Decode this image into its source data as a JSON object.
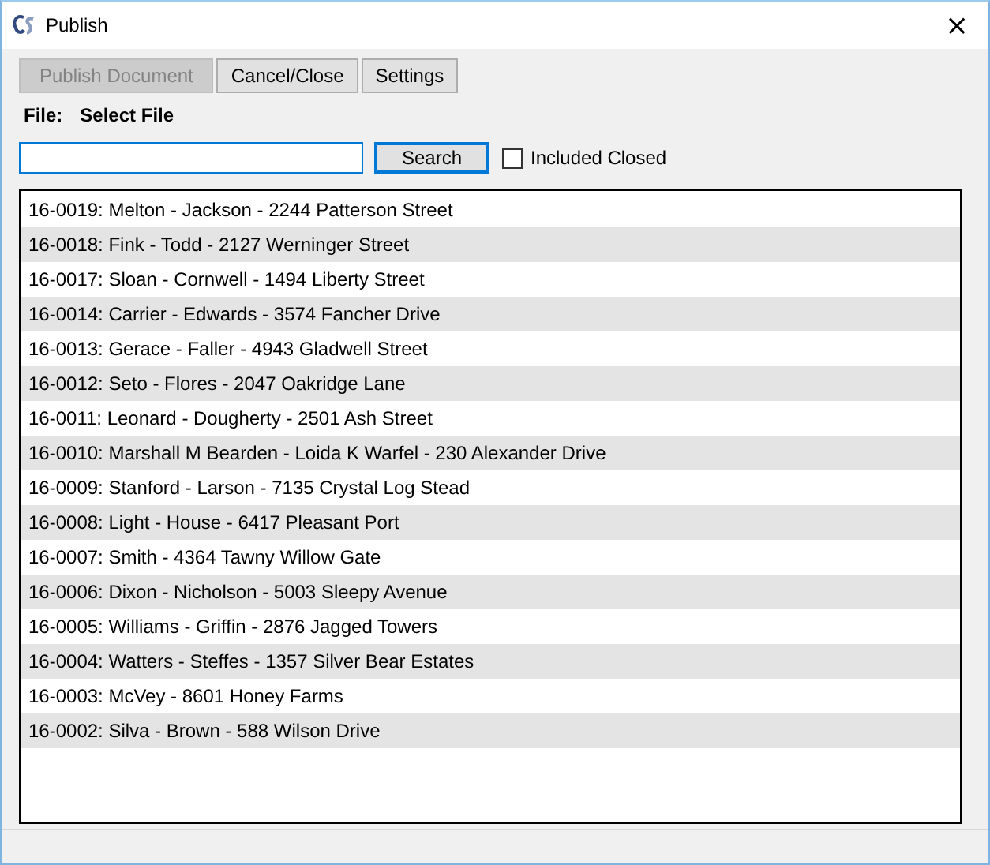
{
  "window": {
    "title": "Publish",
    "close": "×"
  },
  "toolbar": [
    {
      "label": "Publish Document",
      "disabled": true
    },
    {
      "label": "Cancel/Close",
      "disabled": false
    },
    {
      "label": "Settings",
      "disabled": false
    }
  ],
  "file": {
    "label": "File:",
    "value": "Select File"
  },
  "search": {
    "button": "Search",
    "focused": true
  },
  "include_closed": {
    "label": "Included Closed",
    "checked": false
  },
  "files": [
    "16-0019: Melton - Jackson - 2244 Patterson Street",
    "16-0018: Fink - Todd - 2127 Werninger Street",
    "16-0017: Sloan - Cornwell - 1494 Liberty Street",
    "16-0014: Carrier - Edwards - 3574 Fancher Drive",
    "16-0013: Gerace - Faller - 4943 Gladwell Street",
    "16-0012: Seto - Flores - 2047 Oakridge Lane",
    "16-0011: Leonard - Dougherty - 2501 Ash Street",
    "16-0010: Marshall M Bearden - Loida K Warfel - 230 Alexander Drive",
    "16-0009: Stanford - Larson - 7135 Crystal Log Stead",
    "16-0008: Light - House - 6417 Pleasant Port",
    "16-0007: Smith - 4364 Tawny Willow Gate",
    "16-0006: Dixon - Nicholson - 5003 Sleepy Avenue",
    "16-0005: Williams - Griffin - 2876 Jagged Towers",
    "16-0004: Watters - Steffes - 1357 Silver Bear Estates",
    "16-0003: McVey - 8601 Honey Farms",
    "16-0002: Silva - Brown - 588 Wilson Drive"
  ]
}
